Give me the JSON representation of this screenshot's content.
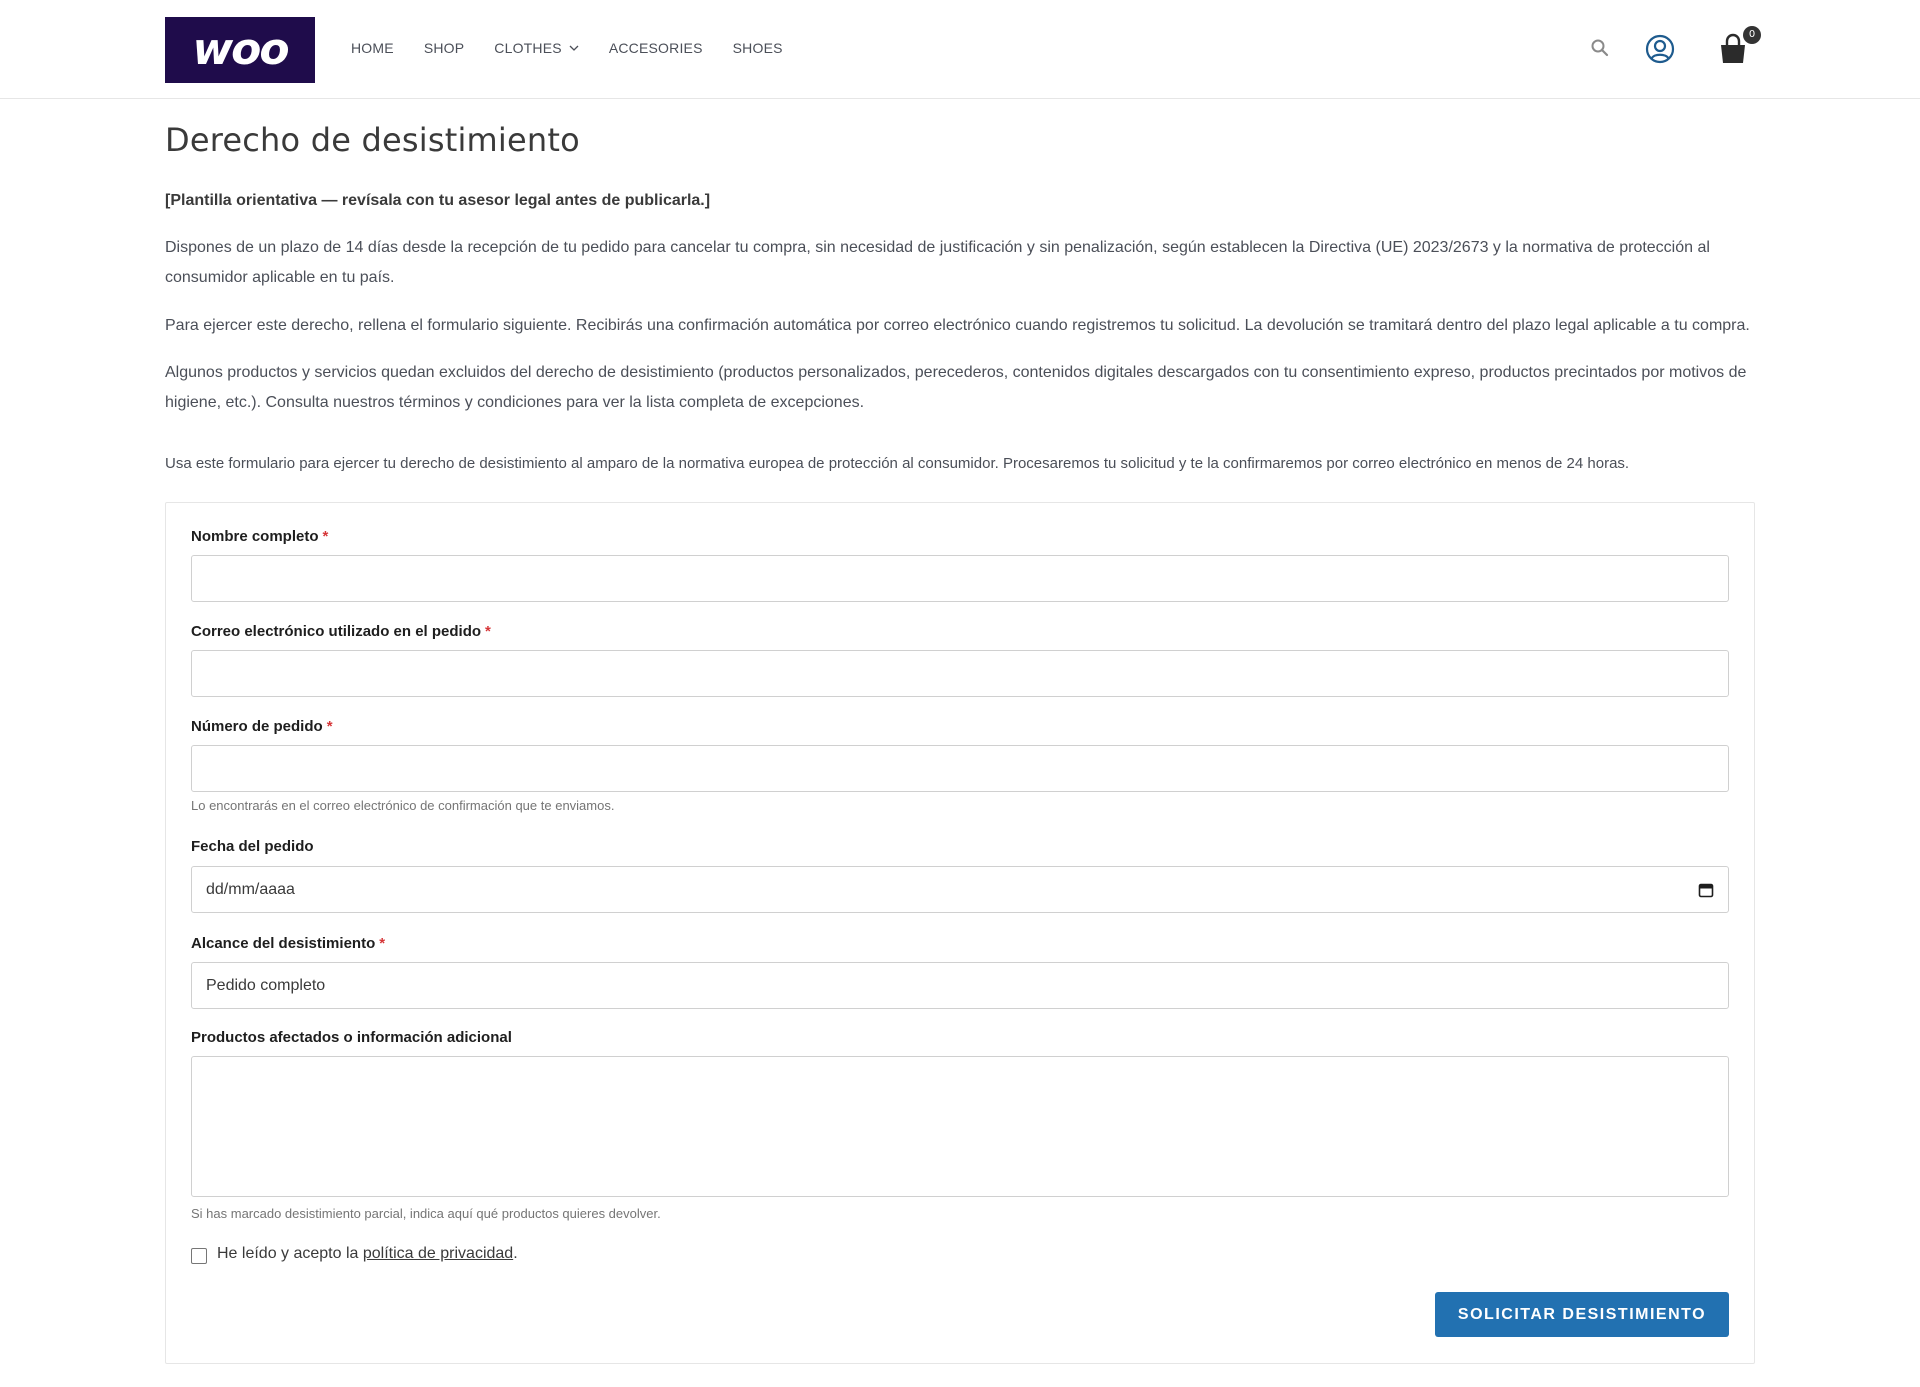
{
  "header": {
    "logo_text": "woo",
    "nav": [
      {
        "label": "HOME"
      },
      {
        "label": "SHOP"
      },
      {
        "label": "CLOTHES",
        "has_dropdown": true
      },
      {
        "label": "ACCESORIES"
      },
      {
        "label": "SHOES"
      }
    ],
    "cart_count": "0",
    "icons": [
      "search-icon",
      "user-icon",
      "cart-icon"
    ]
  },
  "page": {
    "title": "Derecho de desistimiento",
    "note": "[Plantilla orientativa — revísala con tu asesor legal antes de publicarla.]",
    "paragraphs": [
      "Dispones de un plazo de 14 días desde la recepción de tu pedido para cancelar tu compra, sin necesidad de justificación y sin penalización, según establecen la Directiva (UE) 2023/2673 y la normativa de protección al consumidor aplicable en tu país.",
      "Para ejercer este derecho, rellena el formulario siguiente. Recibirás una confirmación automática por correo electrónico cuando registremos tu solicitud. La devolución se tramitará dentro del plazo legal aplicable a tu compra.",
      "Algunos productos y servicios quedan excluidos del derecho de desistimiento (productos personalizados, perecederos, contenidos digitales descargados con tu consentimiento expreso, productos precintados por motivos de higiene, etc.). Consulta nuestros términos y condiciones para ver la lista completa de excepciones."
    ],
    "form_intro": "Usa este formulario para ejercer tu derecho de desistimiento al amparo de la normativa europea de protección al consumidor. Procesaremos tu solicitud y te la confirmaremos por correo electrónico en menos de 24 horas."
  },
  "form": {
    "name_label": "Nombre completo",
    "name_value": "",
    "email_label": "Correo electrónico utilizado en el pedido",
    "email_value": "",
    "order_label": "Número de pedido",
    "order_value": "",
    "order_help": "Lo encontrarás en el correo electrónico de confirmación que te enviamos.",
    "date_label": "Fecha del pedido",
    "date_placeholder": "dd/mm/aaaa",
    "scope_label": "Alcance del desistimiento",
    "scope_value": "Pedido completo",
    "products_label": "Productos afectados o información adicional",
    "products_value": "",
    "products_help": "Si has marcado desistimiento parcial, indica aquí qué productos quieres devolver.",
    "required_mark": "*",
    "consent_prefix": "He leído y acepto la",
    "consent_link": "política de privacidad",
    "consent_suffix": ".",
    "consent_checked": false,
    "submit_label": "SOLICITAR DESISTIMIENTO"
  },
  "colors": {
    "logo_bg": "#1f0c4b",
    "accent": "#2271b1",
    "required": "#d63638"
  }
}
